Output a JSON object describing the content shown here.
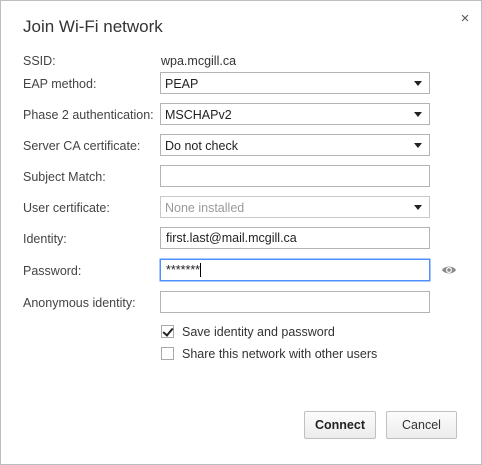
{
  "dialog": {
    "title": "Join Wi-Fi network",
    "close_icon": "×"
  },
  "form": {
    "ssid": {
      "label": "SSID:",
      "value": "wpa.mcgill.ca"
    },
    "eap_method": {
      "label": "EAP method:",
      "value": "PEAP"
    },
    "phase2": {
      "label": "Phase 2 authentication:",
      "value": "MSCHAPv2"
    },
    "server_ca": {
      "label": "Server CA certificate:",
      "value": "Do not check"
    },
    "subject_match": {
      "label": "Subject Match:",
      "value": ""
    },
    "user_cert": {
      "label": "User certificate:",
      "value": "None installed"
    },
    "identity": {
      "label": "Identity:",
      "value": "first.last@mail.mcgill.ca"
    },
    "password": {
      "label": "Password:",
      "value": "*******"
    },
    "anonymous_identity": {
      "label": "Anonymous identity:",
      "value": ""
    }
  },
  "options": {
    "save_identity": {
      "label": "Save identity and password",
      "checked": true
    },
    "share_network": {
      "label": "Share this network with other users",
      "checked": false
    }
  },
  "buttons": {
    "connect": "Connect",
    "cancel": "Cancel"
  },
  "icons": {
    "password_toggle": "eye-icon",
    "dropdown": "chevron-down-icon",
    "close": "close-icon"
  },
  "colors": {
    "focus_border": "#4d90fe"
  }
}
